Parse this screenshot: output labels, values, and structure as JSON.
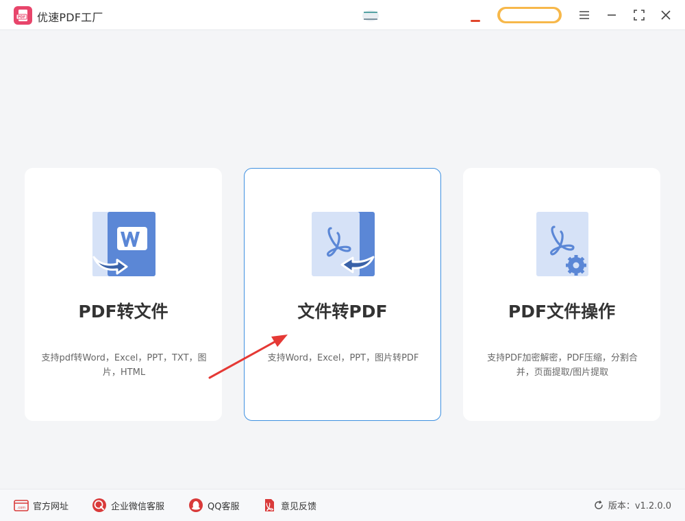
{
  "app": {
    "title": "优速PDF工厂",
    "logo_text": "PDF"
  },
  "colors": {
    "accent": "#3d8fe0",
    "brand": "#e8456b",
    "icon_blue": "#5b87d6",
    "icon_light": "#d6e2f7",
    "footer_red": "#d93a3a",
    "annotation": "#e53935"
  },
  "cards": [
    {
      "title": "PDF转文件",
      "desc": "支持pdf转Word，Excel，PPT，TXT，图片，HTML",
      "icon": "pdf-to-word-icon",
      "selected": false
    },
    {
      "title": "文件转PDF",
      "desc": "支持Word，Excel，PPT，图片转PDF",
      "icon": "file-to-pdf-icon",
      "selected": true
    },
    {
      "title": "PDF文件操作",
      "desc": "支持PDF加密解密，PDF压缩，分割合并，页面提取/图片提取",
      "icon": "pdf-operations-icon",
      "selected": false
    }
  ],
  "footer": {
    "links": [
      {
        "label": "官方网址",
        "icon": "website-icon"
      },
      {
        "label": "企业微信客服",
        "icon": "wecom-icon"
      },
      {
        "label": "QQ客服",
        "icon": "qq-icon"
      },
      {
        "label": "意见反馈",
        "icon": "feedback-icon"
      }
    ],
    "version": "版本：v1.2.0.0"
  }
}
